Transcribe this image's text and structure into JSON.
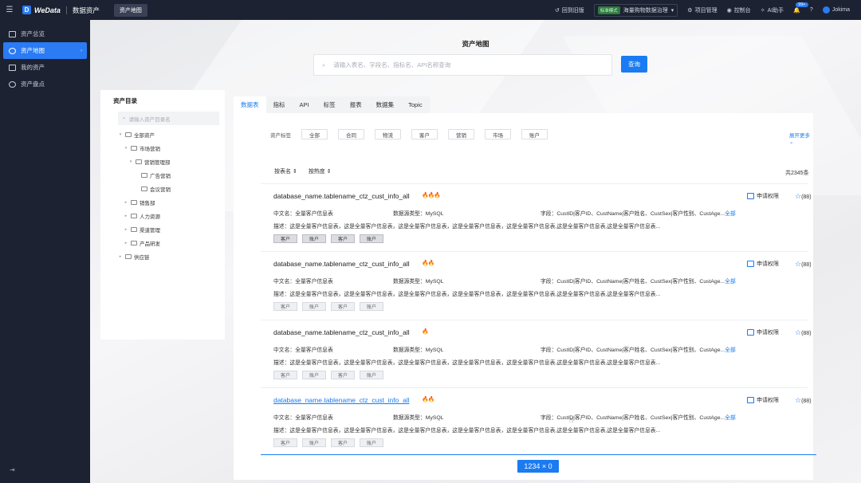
{
  "app": {
    "brand": "WeData",
    "logo_letter": "D",
    "module": "数据资产",
    "active_top_tab": "资产地图"
  },
  "topbar": {
    "back": "回到旧版",
    "mode_tag": "标准模式",
    "project": "海量购物数据治理",
    "items": [
      "项目管理",
      "控制台",
      "AI助手"
    ],
    "notification_badge": "99+",
    "user": "Jokima"
  },
  "sidebar": {
    "items": [
      {
        "label": "资产总览",
        "icon": "dashboard-icon"
      },
      {
        "label": "资产地图",
        "icon": "compass-icon",
        "active": true
      },
      {
        "label": "我的资产",
        "icon": "list-icon"
      },
      {
        "label": "资产盘点",
        "icon": "clock-icon"
      }
    ]
  },
  "main": {
    "title": "资产地图",
    "search_placeholder": "请输入表名、字段名、指标名、API名称查询",
    "search_button": "查询"
  },
  "catalog": {
    "title": "资产目录",
    "search_placeholder": "请输入资产目录名",
    "nodes": [
      {
        "label": "全部资产",
        "level": 0,
        "arrow": "▾"
      },
      {
        "label": "市场营销",
        "level": 1,
        "arrow": "▾"
      },
      {
        "label": "营销管理部",
        "level": 2,
        "arrow": "▾"
      },
      {
        "label": "广告营销",
        "level": 3,
        "arrow": ""
      },
      {
        "label": "会议营销",
        "level": 3,
        "arrow": ""
      },
      {
        "label": "销售部",
        "level": 1,
        "arrow": "▸"
      },
      {
        "label": "人力资源",
        "level": 1,
        "arrow": "▸"
      },
      {
        "label": "渠道管理",
        "level": 1,
        "arrow": "▸"
      },
      {
        "label": "产品研发",
        "level": 1,
        "arrow": "▸"
      },
      {
        "label": "供应链",
        "level": 0,
        "arrow": "▸"
      }
    ]
  },
  "tabs": [
    "数据表",
    "指标",
    "API",
    "标签",
    "报表",
    "数据集",
    "Topic"
  ],
  "filter": {
    "label": "资产标签",
    "tags": [
      "全部",
      "合同",
      "物流",
      "客户",
      "营销",
      "市场",
      "账户"
    ],
    "more": "展开更多"
  },
  "sort": {
    "by_name": "按表名",
    "by_heat": "按热度",
    "total": "共2345条"
  },
  "results": [
    {
      "name": "database_name.tablename_ctz_cust_info_all",
      "fires": "🔥🔥🔥",
      "cn_name_label": "中文名：",
      "cn_name": "全量客户信息表",
      "src_label": "数据源类型：",
      "src": "MySQL",
      "fields": "字段：CustID|客户ID、CustName|客户姓名、CustSex|客户性别、CustAge...",
      "all": "全部",
      "desc": "描述：这是全量客户信息表，这是全量客户信息表，这是全量客户信息表，这是全量客户信息表，这是全量客户信息表,这是全量客户信息表,这是全量客户信息表...",
      "chips": [
        "客户",
        "账户",
        "客户",
        "账户"
      ],
      "perm": "申请权限",
      "stars": "(88)"
    },
    {
      "name": "database_name.tablename_ctz_cust_info_all",
      "fires": "🔥🔥",
      "cn_name_label": "中文名：",
      "cn_name": "全量客户信息表",
      "src_label": "数据源类型：",
      "src": "MySQL",
      "fields": "字段：CustID|客户ID、CustName|客户姓名、CustSex|客户性别、CustAge...",
      "all": "全部",
      "desc": "描述：这是全量客户信息表，这是全量客户信息表，这是全量客户信息表，这是全量客户信息表，这是全量客户信息表,这是全量客户信息表,这是全量客户信息表...",
      "chips": [
        "客户",
        "账户",
        "客户",
        "账户"
      ],
      "perm": "申请权限",
      "stars": "(88)"
    },
    {
      "name": "database_name.tablename_ctz_cust_info_all",
      "fires": "🔥",
      "cn_name_label": "中文名：",
      "cn_name": "全量客户信息表",
      "src_label": "数据源类型：",
      "src": "MySQL",
      "fields": "字段：CustID|客户ID、CustName|客户姓名、CustSex|客户性别、CustAge...",
      "all": "全部",
      "desc": "描述：这是全量客户信息表，这是全量客户信息表，这是全量客户信息表，这是全量客户信息表，这是全量客户信息表,这是全量客户信息表,这是全量客户信息表...",
      "chips": [
        "客户",
        "账户",
        "客户",
        "账户"
      ],
      "perm": "申请权限",
      "stars": "(88)"
    },
    {
      "name": "database_name.tablename_ctz_cust_info_all",
      "fires": "🔥🔥",
      "cn_name_label": "中文名：",
      "cn_name": "全量客户信息表",
      "src_label": "数据源类型：",
      "src": "MySQL",
      "fields": "字段：CustID|客户ID、CustName|客户姓名、CustSex|客户性别、CustAge...",
      "all": "全部",
      "desc": "描述：这是全量客户信息表，这是全量客户信息表，这是全量客户信息表，这是全量客户信息表，这是全量客户信息表,这是全量客户信息表,这是全量客户信息表...",
      "chips": [
        "客户",
        "账户",
        "客户",
        "账户"
      ],
      "perm": "申请权限",
      "stars": "(88)"
    }
  ],
  "size_badge": "1234 × 0",
  "colors": {
    "accent": "#1a7bf2",
    "nav_bg": "#1c2232",
    "fire": "#f07a19"
  }
}
